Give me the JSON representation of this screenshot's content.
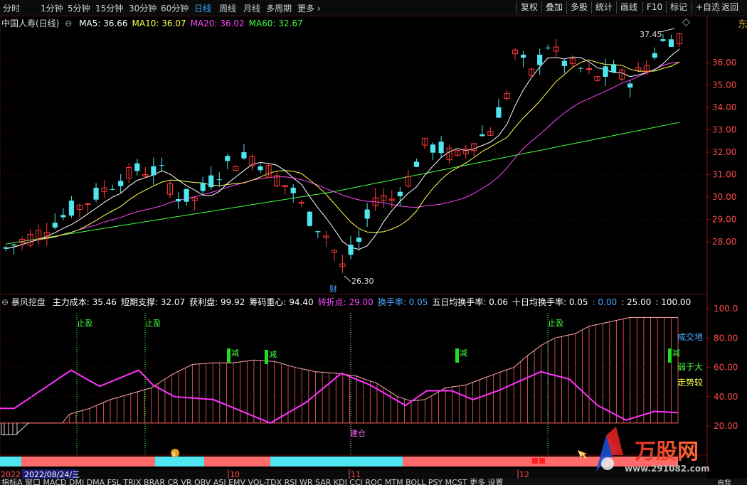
{
  "toolbar": {
    "periods": [
      "分时",
      "1分钟",
      "5分钟",
      "15分钟",
      "30分钟",
      "60分钟",
      "日线",
      "周线",
      "月线",
      "多周期",
      "更多"
    ],
    "active_period": "日线",
    "right_buttons": [
      "复权",
      "叠加",
      "多股",
      "统计",
      "画线",
      "F10",
      "标记",
      "+自选",
      "返回"
    ]
  },
  "kline": {
    "title": "中国人寿(日线)",
    "ma": [
      {
        "label": "MA5: 36.66",
        "color": "#ffffff"
      },
      {
        "label": "MA10: 36.07",
        "color": "#ffff55"
      },
      {
        "label": "MA20: 36.02",
        "color": "#ff44ff"
      },
      {
        "label": "MA60: 32.67",
        "color": "#44ff44"
      }
    ],
    "price_axis": [
      "36.00",
      "35.00",
      "34.00",
      "33.00",
      "32.00",
      "31.00",
      "30.00",
      "29.00",
      "28.00"
    ],
    "high_label": "37.45",
    "low_label": "26.30",
    "finance_marker": "财",
    "right_edge_text": "东"
  },
  "indicator": {
    "name": "暴风挖盘",
    "params": [
      {
        "label": "主力成本: 35.46",
        "color": "#ffffff"
      },
      {
        "label": "短期支撑: 32.07",
        "color": "#ffffff"
      },
      {
        "label": "获利盘: 99.92",
        "color": "#ffffff"
      },
      {
        "label": "筹码重心: 94.40",
        "color": "#ffffff"
      },
      {
        "label": "转折点: 29.00",
        "color": "#ff44ff"
      },
      {
        "label": "换手率: 0.05",
        "color": "#4aa8ff"
      },
      {
        "label": "五日均换手率: 0.06",
        "color": "#ffffff"
      },
      {
        "label": "十日均换手率: 0.05",
        "color": "#ffffff"
      },
      {
        "label": ": 0.00",
        "color": "#4aa8ff"
      },
      {
        "label": ": 25.00",
        "color": "#ffffff"
      },
      {
        "label": ": 100.00",
        "color": "#ffffff"
      }
    ],
    "axis": [
      "100.0",
      "80.00",
      "60.00",
      "40.00",
      "20.00"
    ],
    "take_profit_label": "止盈",
    "reduce_label": "减",
    "build_label": "建仓",
    "right_labels": [
      {
        "text": "成交地",
        "color": "#4aa8ff"
      },
      {
        "text": "弱于大",
        "color": "#44ff44"
      },
      {
        "text": "走势较",
        "color": "#ffff55"
      }
    ]
  },
  "time_axis": {
    "year": "2022",
    "cursor_date": "2022/08/24/三",
    "months": [
      "10",
      "11",
      "12"
    ]
  },
  "watermark": {
    "brand": "万股网",
    "url": "www.291082.com"
  },
  "bottom_tabs_text": "指标A 窗口 MACD DMI DMA FSL TRIX BRAR CR VR OBV ASI EMV VOL-TDX RSI WR SAR KDJ CCI ROC MTM BOLL PSY MCST 更多 设置",
  "bottom_right_text": "自我"
}
